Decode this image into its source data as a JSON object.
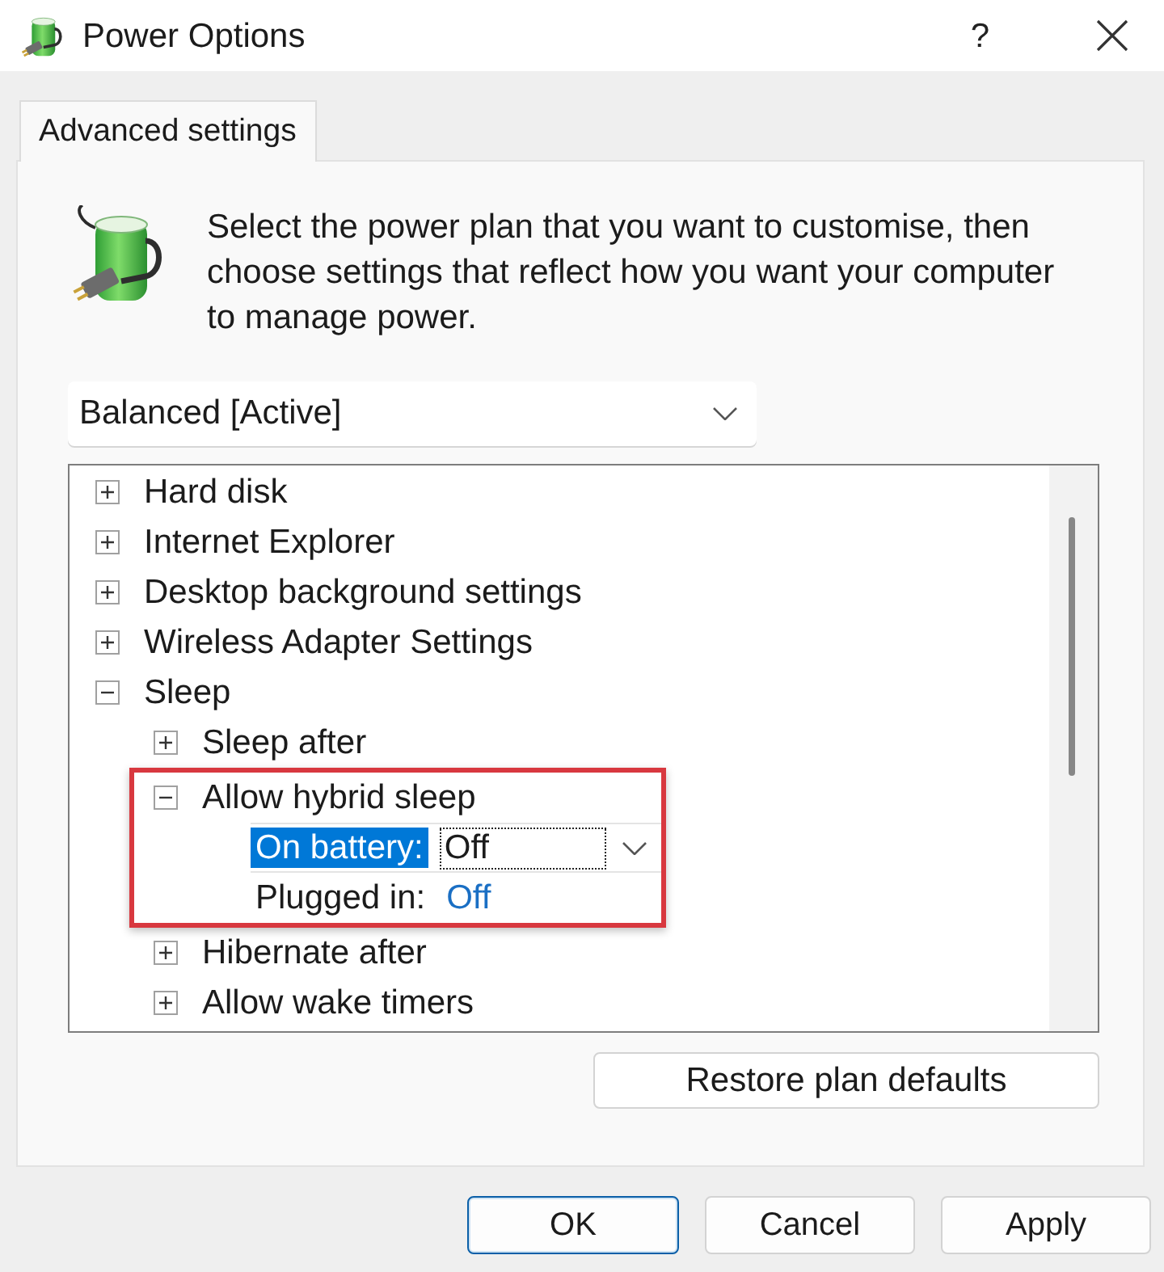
{
  "window": {
    "title": "Power Options",
    "help_button": "?"
  },
  "tabs": [
    {
      "label": "Advanced settings",
      "selected": true
    }
  ],
  "description": "Select the power plan that you want to customise, then choose settings that reflect how you want your computer to manage power.",
  "plan_dropdown": {
    "value": "Balanced [Active]"
  },
  "settings_tree": [
    {
      "kind": "category",
      "label": "Hard disk",
      "expanded": false
    },
    {
      "kind": "category",
      "label": "Internet Explorer",
      "expanded": false
    },
    {
      "kind": "category",
      "label": "Desktop background settings",
      "expanded": false
    },
    {
      "kind": "category",
      "label": "Wireless Adapter Settings",
      "expanded": false
    },
    {
      "kind": "category",
      "label": "Sleep",
      "expanded": true,
      "children": [
        {
          "kind": "category",
          "label": "Sleep after",
          "expanded": false,
          "highlighted": false
        },
        {
          "kind": "category",
          "label": "Allow hybrid sleep",
          "expanded": true,
          "highlighted": true,
          "children": [
            {
              "kind": "setting",
              "label": "On battery:",
              "value": "Off",
              "selected": true,
              "editing": true
            },
            {
              "kind": "setting",
              "label": "Plugged in:",
              "value": "Off",
              "selected": false,
              "editing": false
            }
          ]
        },
        {
          "kind": "category",
          "label": "Hibernate after",
          "expanded": false,
          "highlighted": false
        },
        {
          "kind": "category",
          "label": "Allow wake timers",
          "expanded": false,
          "highlighted": false
        }
      ]
    }
  ],
  "restore_button": {
    "label": "Restore plan defaults"
  },
  "buttons": [
    {
      "label": "OK",
      "default": true
    },
    {
      "label": "Cancel",
      "default": false
    },
    {
      "label": "Apply",
      "default": false
    }
  ]
}
